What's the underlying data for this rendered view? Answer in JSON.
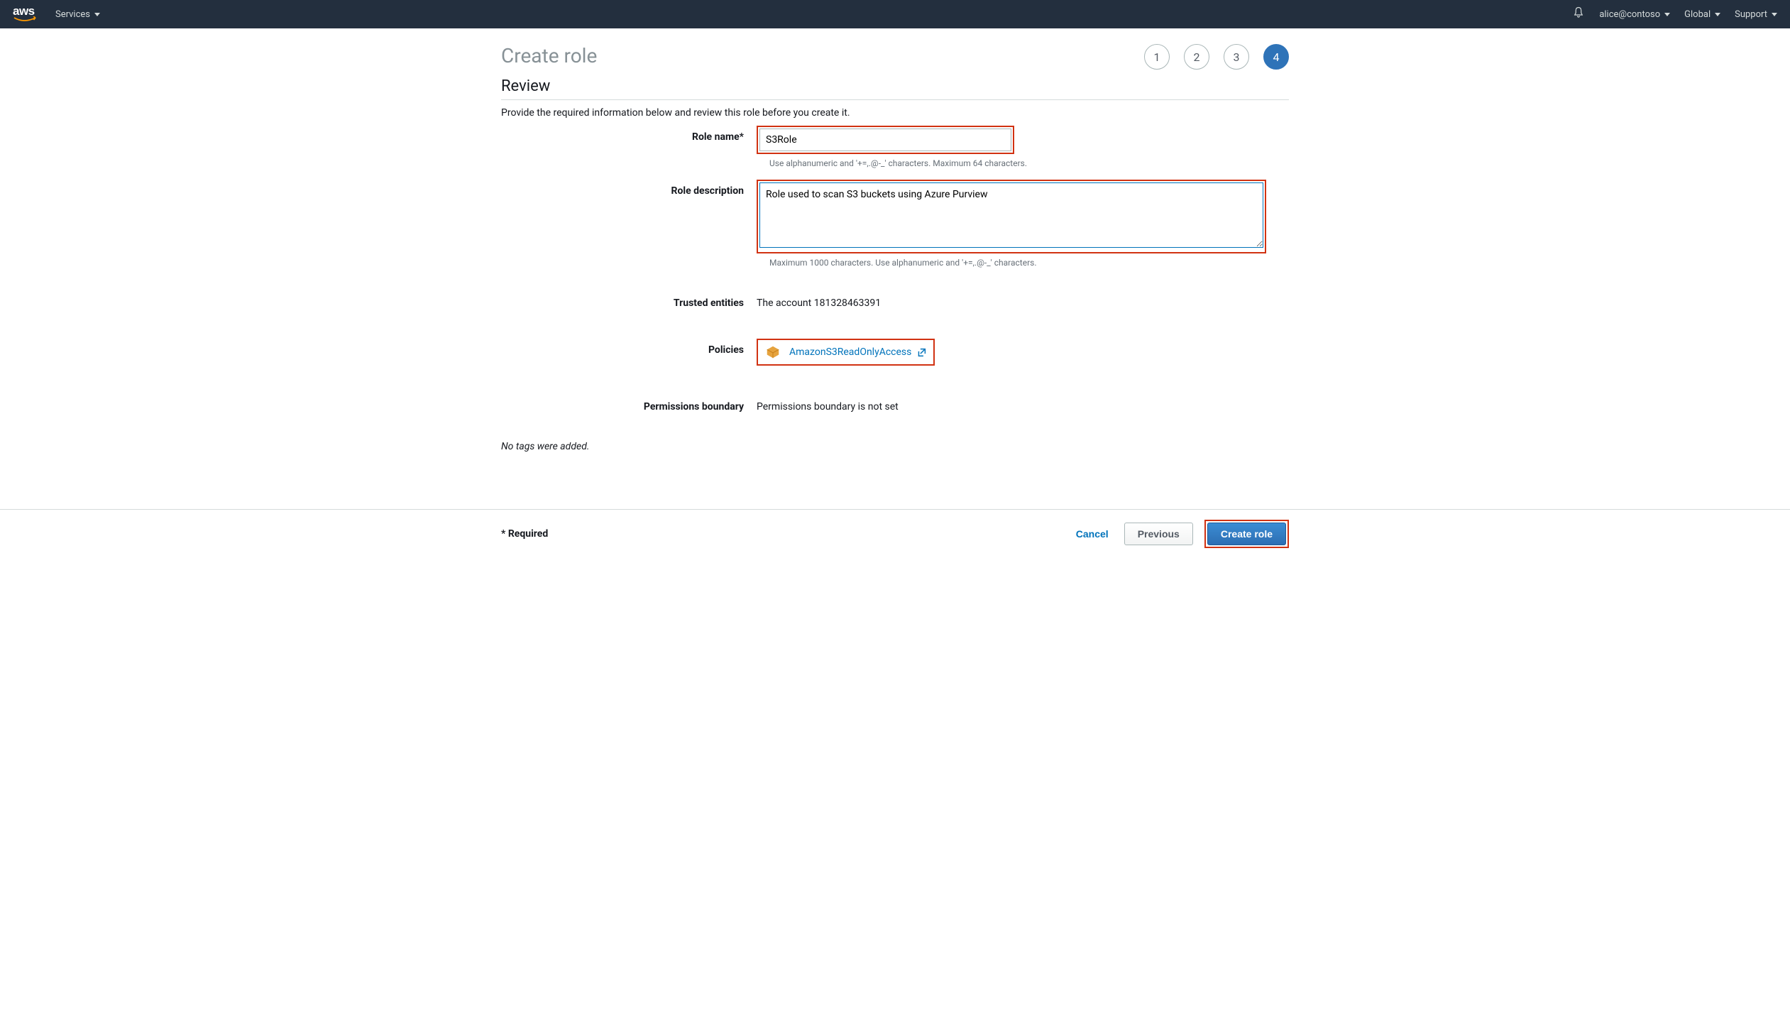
{
  "nav": {
    "services": "Services",
    "account": "alice@contoso",
    "region": "Global",
    "support": "Support"
  },
  "page": {
    "title": "Create role",
    "steps": [
      "1",
      "2",
      "3",
      "4"
    ],
    "active_step_index": 3
  },
  "review": {
    "heading": "Review",
    "instructions": "Provide the required information below and review this role before you create it.",
    "role_name_label": "Role name*",
    "role_name_value": "S3Role",
    "role_name_hint": "Use alphanumeric and '+=,.@-_' characters. Maximum 64 characters.",
    "role_desc_label": "Role description",
    "role_desc_value": "Role used to scan S3 buckets using Azure Purview",
    "role_desc_hint": "Maximum 1000 characters. Use alphanumeric and '+=,.@-_' characters.",
    "trusted_label": "Trusted entities",
    "trusted_value": "The account 181328463391",
    "policies_label": "Policies",
    "policy_name": "AmazonS3ReadOnlyAccess",
    "perm_boundary_label": "Permissions boundary",
    "perm_boundary_value": "Permissions boundary is not set",
    "no_tags": "No tags were added."
  },
  "footer": {
    "required": "* Required",
    "cancel": "Cancel",
    "previous": "Previous",
    "create": "Create role"
  }
}
